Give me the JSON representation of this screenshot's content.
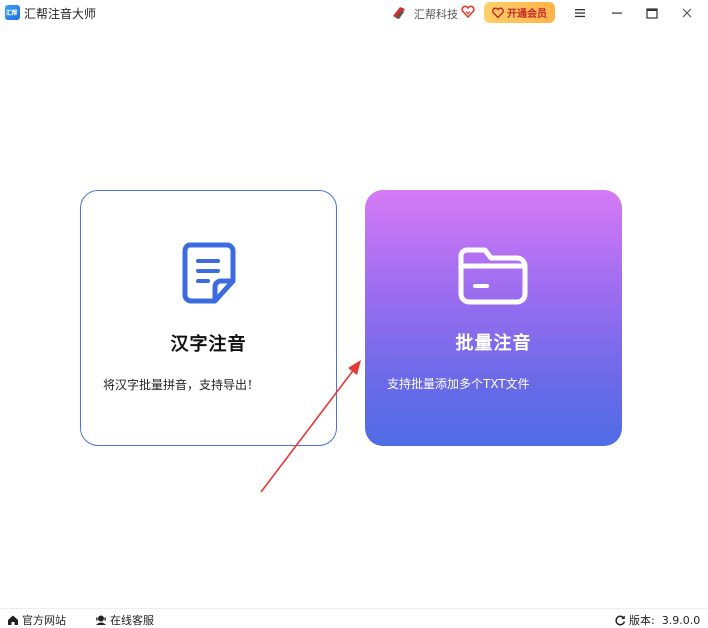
{
  "app": {
    "logo_text": "汇帮",
    "title": "汇帮注音大师"
  },
  "header": {
    "brand_name": "汇帮科技",
    "vip_label": "开通会员"
  },
  "cards": {
    "hanzi": {
      "title": "汉字注音",
      "desc": "将汉字批量拼音，支持导出！"
    },
    "batch": {
      "title": "批量注音",
      "desc": "支持批量添加多个TXT文件"
    }
  },
  "footer": {
    "site_label": "官方网站",
    "service_label": "在线客服",
    "version_label": "版本:",
    "version_value": "3.9.0.0"
  },
  "colors": {
    "vip_bg": "#ffb347",
    "vip_text": "#c0262c",
    "card_border": "#4c73d6",
    "card_icon_blue": "#3c6be0",
    "batch_gradient_top": "#d57af6",
    "batch_gradient_bottom": "#4f6ce5",
    "arrow_red": "#e53935"
  },
  "icons": {
    "brand": "brand-logo-icon",
    "heart": "heart-icon",
    "menu": "hamburger-icon",
    "minimize": "minimize-icon",
    "maximize": "maximize-icon",
    "close": "close-icon",
    "document": "document-icon",
    "folder": "folder-icon",
    "home": "home-icon",
    "service": "headset-icon",
    "refresh": "refresh-icon"
  }
}
